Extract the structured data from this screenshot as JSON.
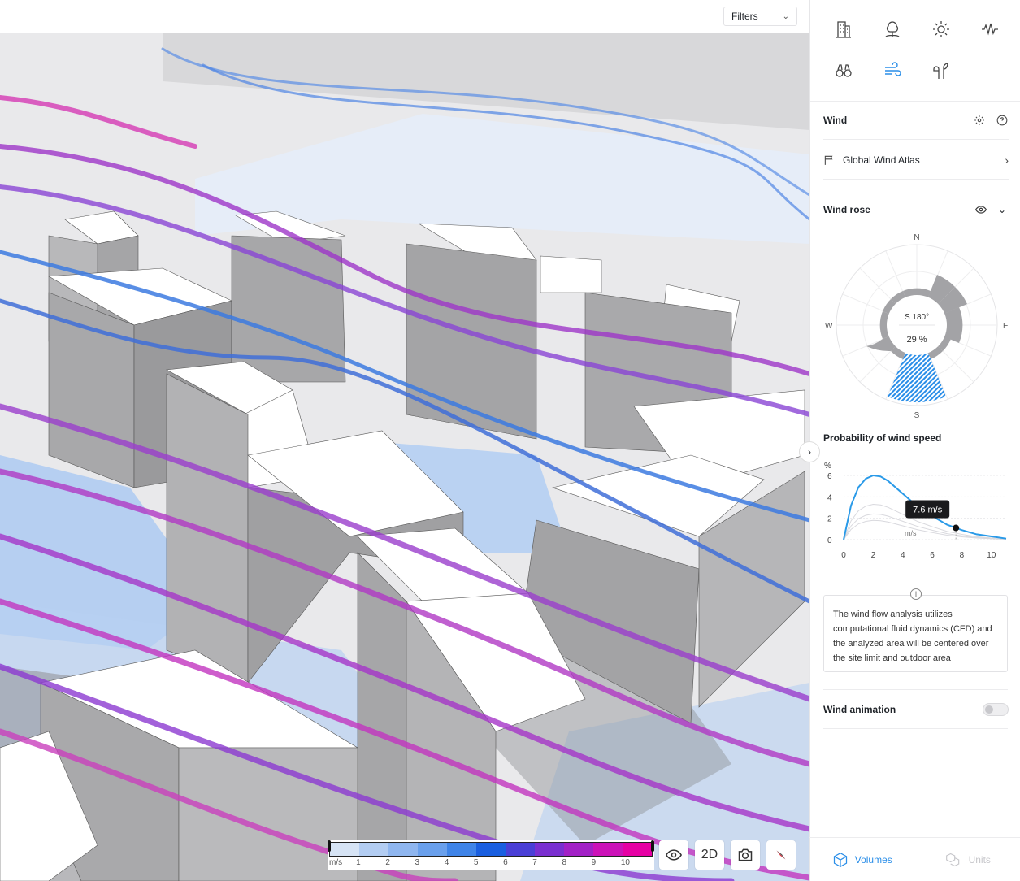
{
  "toolbar": {
    "filters_label": "Filters"
  },
  "tools": [
    {
      "icon": "building-icon"
    },
    {
      "icon": "tree-icon"
    },
    {
      "icon": "sun-icon"
    },
    {
      "icon": "noise-wave-icon"
    },
    {
      "icon": "binoculars-icon"
    },
    {
      "icon": "wind-icon",
      "active": true
    },
    {
      "icon": "eco-plant-icon"
    }
  ],
  "wind": {
    "title": "Wind",
    "source": "Global Wind Atlas",
    "windrose": {
      "title": "Wind rose",
      "n": "N",
      "e": "E",
      "s": "S",
      "w": "W",
      "center_direction": "S 180°",
      "center_value": "29 %"
    },
    "probability": {
      "title": "Probability of wind speed",
      "y_unit": "%",
      "x_unit": "m/s",
      "tooltip": "7.6 m/s",
      "y_ticks": [
        "0",
        "2",
        "4",
        "6"
      ],
      "x_ticks": [
        "0",
        "2",
        "4",
        "6",
        "8",
        "10"
      ]
    },
    "info_text": "The wind flow analysis utilizes computational fluid dynamics (CFD) and the analyzed area will be centered over the site limit and outdoor area",
    "animation_label": "Wind animation",
    "animation_on": false
  },
  "legend": {
    "unit": "m/s",
    "ticks": [
      "1",
      "2",
      "3",
      "4",
      "5",
      "6",
      "7",
      "8",
      "9",
      "10"
    ],
    "colors": [
      "#d7e4f5",
      "#b3cdf2",
      "#8fb6ef",
      "#6aa0ec",
      "#3f84e8",
      "#1a5fe0",
      "#4a3fd6",
      "#7a2fd0",
      "#a221c6",
      "#cc12b8",
      "#e600a4"
    ]
  },
  "view_controls": {
    "mode_label": "2D"
  },
  "bottom_tabs": {
    "volumes": "Volumes",
    "units": "Units"
  },
  "chart_data": {
    "type": "line",
    "title": "Probability of wind speed",
    "xlabel": "m/s",
    "ylabel": "%",
    "xlim": [
      0,
      11
    ],
    "ylim": [
      0,
      6
    ],
    "series": [
      {
        "x": [
          0,
          0.5,
          1,
          1.5,
          2,
          2.5,
          3,
          4,
          5,
          6,
          7,
          7.6,
          8,
          9,
          10,
          11
        ],
        "values": [
          0,
          3.2,
          4.9,
          5.7,
          6.0,
          5.9,
          5.5,
          4.3,
          3.1,
          2.2,
          1.4,
          1.1,
          0.9,
          0.5,
          0.3,
          0.1
        ]
      }
    ],
    "highlight": {
      "x": 7.6,
      "y": 1.1,
      "label": "7.6 m/s"
    }
  }
}
